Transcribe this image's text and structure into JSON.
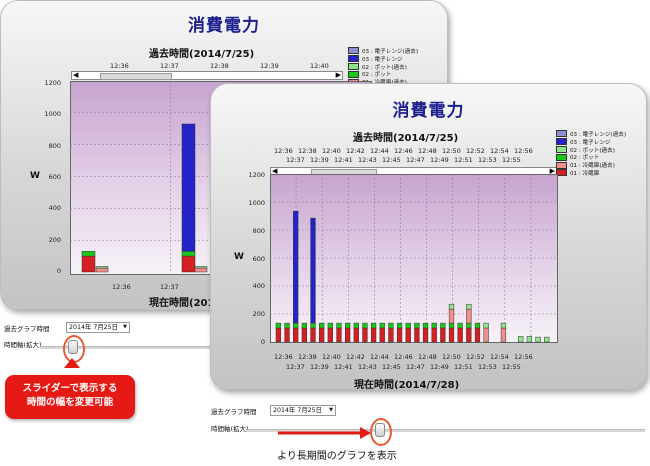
{
  "screens": {
    "back": {
      "title": "消費電力",
      "top_axis_title": "過去時間(2014/7/25)",
      "bottom_axis_title": "現在時間(2014/7/25)",
      "ylabel": "W",
      "top_ticks": [
        "12:36",
        "12:37",
        "12:38",
        "12:39",
        "12:40"
      ],
      "bottom_ticks": [
        "12:36",
        "12:37"
      ],
      "yticks": [
        "1200",
        "1000",
        "800",
        "600",
        "400",
        "200",
        "0"
      ],
      "legend": [
        {
          "label": "03 : 電子レンジ(過去)",
          "color": "#8f8fd6"
        },
        {
          "label": "03 : 電子レンジ",
          "color": "#2323c9"
        },
        {
          "label": "02 : ポット(過去)",
          "color": "#8ae889"
        },
        {
          "label": "02 : ポット",
          "color": "#19c819"
        },
        {
          "label": "01 : 冷蔵庫(過去)",
          "color": "#f08e8e"
        },
        {
          "label": "01 : 冷蔵庫",
          "color": "#d42020"
        }
      ],
      "past_graph_time_label": "過去グラフ時間",
      "date_select_value": "2014年 7月25日",
      "zoom_label": "時間軸(拡大)"
    },
    "front": {
      "title": "消費電力",
      "top_axis_title": "過去時間(2014/7/25)",
      "bottom_axis_title": "現在時間(2014/7/28)",
      "ylabel": "W",
      "top_ticks_row1": [
        "12:36",
        "12:38",
        "12:40",
        "12:42",
        "12:44",
        "12:46",
        "12:48",
        "12:50",
        "12:52",
        "12:54",
        "12:56"
      ],
      "top_ticks_row2": [
        "12:37",
        "12:39",
        "12:41",
        "12:43",
        "12:45",
        "12:47",
        "12:49",
        "12:51",
        "12:53",
        "12:55"
      ],
      "bottom_ticks_row1": [
        "12:36",
        "12:38",
        "12:40",
        "12:42",
        "12:44",
        "12:46",
        "12:48",
        "12:50",
        "12:52",
        "12:54",
        "12:56"
      ],
      "bottom_ticks_row2": [
        "12:37",
        "12:39",
        "12:41",
        "12:43",
        "12:45",
        "12:47",
        "12:49",
        "12:51",
        "12:53",
        "12:55"
      ],
      "yticks": [
        "1200",
        "1000",
        "800",
        "600",
        "400",
        "200",
        "0"
      ],
      "legend": [
        {
          "label": "03 : 電子レンジ(過去)",
          "color": "#8f8fd6"
        },
        {
          "label": "03 : 電子レンジ",
          "color": "#2323c9"
        },
        {
          "label": "02 : ポット(過去)",
          "color": "#8ae889"
        },
        {
          "label": "02 : ポット",
          "color": "#19c819"
        },
        {
          "label": "01 : 冷蔵庫(過去)",
          "color": "#f08e8e"
        },
        {
          "label": "01 : 冷蔵庫",
          "color": "#d42020"
        }
      ],
      "past_graph_time_label": "過去グラフ時間",
      "date_select_value": "2014年 7月25日",
      "zoom_label": "時間軸(拡大)"
    }
  },
  "annotations": {
    "callout_line1": "スライダーで表示する",
    "callout_line2": "時間の幅を変更可能",
    "caption": "より長期間のグラフを表示",
    "callout_color": "#e51a14",
    "arrow_color": "#e31d16"
  },
  "chart_data": [
    {
      "type": "bar",
      "stacked": true,
      "ylabel": "W",
      "ylim": [
        0,
        1200
      ],
      "categories": [
        "12:36",
        "12:37"
      ],
      "series": [
        {
          "name": "01 : 冷蔵庫",
          "values": [
            100,
            100
          ]
        },
        {
          "name": "02 : ポット",
          "values": [
            30,
            30
          ]
        },
        {
          "name": "03 : 電子レンジ",
          "values": [
            0,
            800
          ]
        },
        {
          "name": "01 : 冷蔵庫(過去)",
          "values": [
            25,
            25
          ]
        },
        {
          "name": "02 : ポット(過去)",
          "values": [
            10,
            10
          ]
        }
      ]
    },
    {
      "type": "bar",
      "stacked": true,
      "ylabel": "W",
      "ylim": [
        0,
        1200
      ],
      "bar_count": 32,
      "series": [
        {
          "name": "01 : 冷蔵庫",
          "values": [
            100,
            100,
            100,
            100,
            100,
            100,
            100,
            100,
            100,
            100,
            100,
            100,
            100,
            100,
            100,
            100,
            100,
            100,
            100,
            100,
            100,
            100,
            100,
            100,
            0,
            0,
            0,
            0,
            0,
            0,
            0,
            0
          ]
        },
        {
          "name": "02 : ポット",
          "values": [
            35,
            35,
            35,
            35,
            35,
            35,
            35,
            35,
            35,
            35,
            35,
            35,
            35,
            35,
            35,
            35,
            35,
            35,
            35,
            35,
            35,
            35,
            35,
            35,
            0,
            0,
            0,
            0,
            0,
            0,
            0,
            0
          ]
        },
        {
          "name": "03 : 電子レンジ",
          "values": [
            0,
            0,
            800,
            0,
            750,
            0,
            0,
            0,
            0,
            0,
            0,
            0,
            0,
            0,
            0,
            0,
            0,
            0,
            0,
            0,
            0,
            0,
            0,
            0,
            0,
            0,
            0,
            0,
            0,
            0,
            0,
            0
          ]
        },
        {
          "name": "01 : 冷蔵庫(過去)",
          "values": [
            0,
            0,
            0,
            0,
            0,
            0,
            0,
            0,
            0,
            0,
            0,
            0,
            0,
            0,
            0,
            0,
            0,
            0,
            0,
            0,
            100,
            0,
            100,
            0,
            100,
            0,
            100,
            0,
            0,
            0,
            0,
            0
          ]
        },
        {
          "name": "02 : ポット(過去)",
          "values": [
            0,
            0,
            0,
            0,
            0,
            0,
            0,
            0,
            0,
            0,
            0,
            0,
            0,
            0,
            0,
            0,
            0,
            0,
            0,
            0,
            35,
            0,
            35,
            0,
            35,
            0,
            35,
            0,
            40,
            40,
            35,
            35
          ]
        }
      ]
    }
  ]
}
